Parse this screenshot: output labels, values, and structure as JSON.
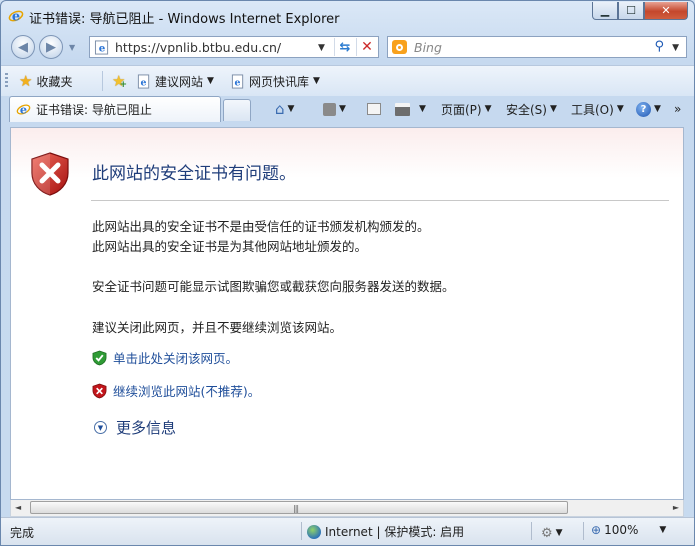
{
  "window": {
    "title": "证书错误: 导航已阻止 - Windows Internet Explorer",
    "min_glyph": "▁",
    "max_glyph": "☐",
    "close_glyph": "✕"
  },
  "address": {
    "url": "https://vpnlib.btbu.edu.cn/",
    "drop_glyph": "▼",
    "refresh_glyph": "⇆",
    "stop_glyph": "✕"
  },
  "search": {
    "placeholder": "Bing",
    "icon_glyph": "⚲",
    "drop_glyph": "▼"
  },
  "favorites": {
    "button_label": "收藏夹",
    "items": [
      {
        "label": "建议网站",
        "icon": "page-icon"
      },
      {
        "label": "网页快讯库",
        "icon": "page-icon"
      }
    ]
  },
  "tab": {
    "label": "证书错误: 导航已阻止"
  },
  "commandbar": {
    "page_label": "页面(P)",
    "safety_label": "安全(S)",
    "tools_label": "工具(O)",
    "drop_glyph": "▼",
    "help_glyph": "?",
    "more_glyph": "»"
  },
  "content": {
    "title": "此网站的安全证书有问题。",
    "line1": "此网站出具的安全证书不是由受信任的证书颁发机构颁发的。",
    "line2": "此网站出具的安全证书是为其他网站地址颁发的。",
    "line3": "安全证书问题可能显示试图欺骗您或截获您向服务器发送的数据。",
    "line4": "建议关闭此网页，并且不要继续浏览该网站。",
    "close_link": "单击此处关闭该网页。",
    "continue_link": "继续浏览此网站(不推荐)。",
    "more_info": "更多信息",
    "more_glyph": "▼"
  },
  "scroll": {
    "left_glyph": "◄",
    "right_glyph": "►",
    "grip_glyph": "|||"
  },
  "status": {
    "text": "完成",
    "zone": "Internet | 保护模式: 启用",
    "zoom": "100%",
    "drop_glyph": "▼"
  },
  "colors": {
    "title_blue": "#1f3d7a",
    "link_blue": "#1f4e9a",
    "shield_red": "#c2151b",
    "shield_green": "#2f9b35"
  }
}
